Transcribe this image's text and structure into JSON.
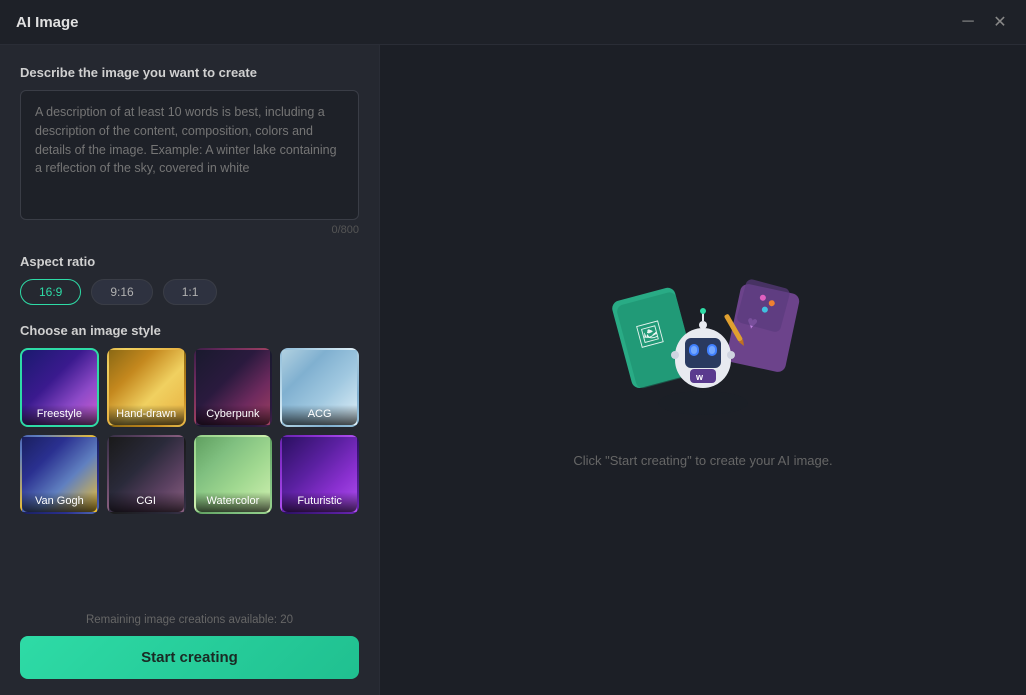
{
  "window": {
    "title": "AI Image",
    "minimize_btn": "─",
    "close_btn": "✕"
  },
  "left_panel": {
    "prompt_section": {
      "label": "Describe the image you want to create",
      "placeholder": "A description of at least 10 words is best, including a description of the content, composition, colors and details of the image. Example: A winter lake containing a reflection of the sky, covered in white",
      "char_count": "0/800"
    },
    "aspect_ratio": {
      "label": "Aspect ratio",
      "options": [
        {
          "value": "16:9",
          "active": true
        },
        {
          "value": "9:16",
          "active": false
        },
        {
          "value": "1:1",
          "active": false
        }
      ]
    },
    "image_style": {
      "label": "Choose an image style",
      "styles": [
        {
          "name": "Freestyle",
          "class": "thumb-freestyle",
          "active": true
        },
        {
          "name": "Hand-drawn",
          "class": "thumb-handdrawn",
          "active": false
        },
        {
          "name": "Cyberpunk",
          "class": "thumb-cyberpunk",
          "active": false
        },
        {
          "name": "ACG",
          "class": "thumb-acg",
          "active": false
        },
        {
          "name": "Van Gogh",
          "class": "thumb-vangogh",
          "active": false
        },
        {
          "name": "CGI",
          "class": "thumb-cgi",
          "active": false
        },
        {
          "name": "Watercolor",
          "class": "thumb-watercolor",
          "active": false
        },
        {
          "name": "Futuristic",
          "class": "thumb-futuristic",
          "active": false
        }
      ]
    },
    "remaining_text": "Remaining image creations available: 20",
    "start_button": "Start creating"
  },
  "right_panel": {
    "hint": "Click \"Start creating\" to create your AI image."
  }
}
